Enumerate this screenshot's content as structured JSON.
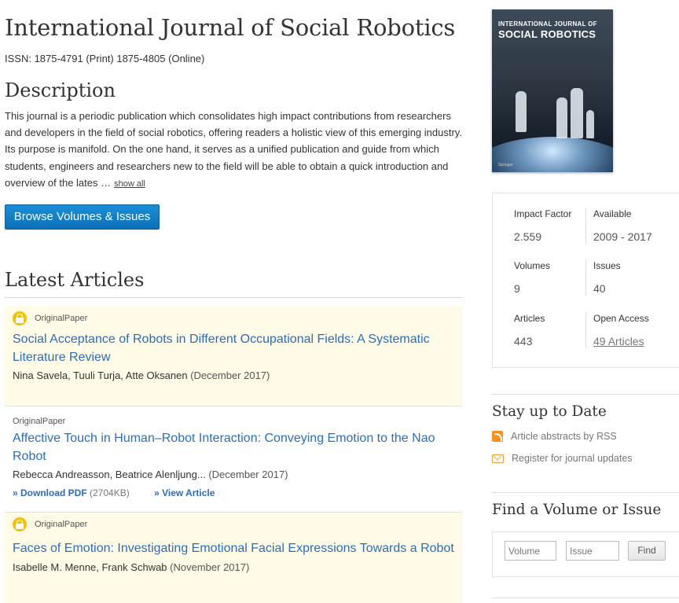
{
  "journal": {
    "title": "International Journal of Social Robotics",
    "issn": "ISSN: 1875-4791 (Print) 1875-4805 (Online)"
  },
  "description": {
    "heading": "Description",
    "text": "This journal is a periodic publication which consolidates high impact contributions from researchers and developers in the field of social robotics, offering readers a holistic view of this emerging industry. Its purpose is manifold. On the one hand, it serves as a unified publication and guide from which students, engineers and researchers new to the field will be able to obtain a quick introduction and overview of the lates …",
    "show_all": "show all"
  },
  "browse_button": "Browse Volumes & Issues",
  "latest": {
    "heading": "Latest Articles",
    "articles": [
      {
        "type": "OriginalPaper",
        "open_access": true,
        "title": "Social Acceptance of Robots in Different Occupational Fields: A Systematic Literature Review",
        "authors": "Nina Savela, Tuuli Turja, Atte Oksanen",
        "date": "(December 2017)"
      },
      {
        "type": "OriginalPaper",
        "open_access": false,
        "title": "Affective Touch in Human–Robot Interaction: Conveying Emotion to the Nao Robot",
        "authors": "Rebecca Andreasson, Beatrice Alenljung...",
        "date": "(December 2017)",
        "download_label": "» Download PDF",
        "download_size": "(2704KB)",
        "view_label": "» View Article"
      },
      {
        "type": "OriginalPaper",
        "open_access": true,
        "title": "Faces of Emotion: Investigating Emotional Facial Expressions Towards a Robot",
        "authors": "Isabelle M. Menne, Frank Schwab",
        "date": "(November 2017)"
      }
    ]
  },
  "cover": {
    "subtitle": "INTERNATIONAL JOURNAL OF",
    "title": "SOCIAL ROBOTICS",
    "publisher": "Springer"
  },
  "stats": {
    "impact_factor_label": "Impact Factor",
    "impact_factor": "2.559",
    "available_label": "Available",
    "available": "2009 - 2017",
    "volumes_label": "Volumes",
    "volumes": "9",
    "issues_label": "Issues",
    "issues": "40",
    "articles_label": "Articles",
    "articles": "443",
    "open_access_label": "Open Access",
    "open_access": "49 Articles"
  },
  "stay_up": {
    "heading": "Stay up to Date",
    "rss": "Article abstracts by RSS",
    "register": "Register for journal updates"
  },
  "find": {
    "heading": "Find a Volume or Issue",
    "volume_placeholder": "Volume",
    "issue_placeholder": "Issue",
    "button": "Find"
  },
  "colors": {
    "link": "#2a6ebb",
    "button": "#1a8fd8",
    "open_access_bg": "#fffbe6",
    "lock": "#f2c200"
  }
}
